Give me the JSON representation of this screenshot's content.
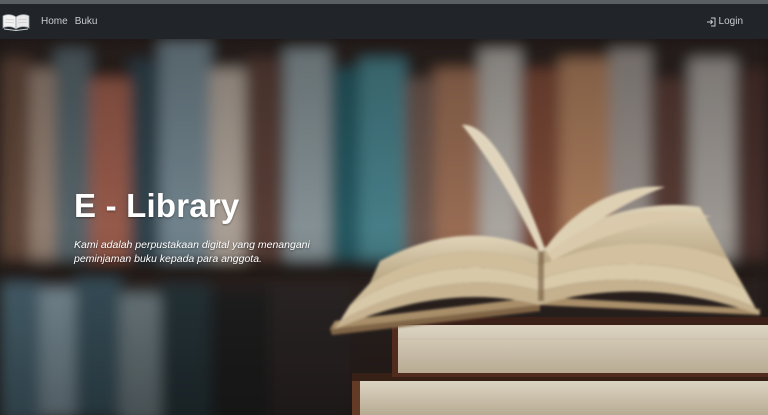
{
  "navbar": {
    "logo_icon": "open-book-icon",
    "links": [
      {
        "label": "Home"
      },
      {
        "label": "Buku"
      }
    ],
    "login": {
      "icon": "login-icon",
      "label": "Login"
    }
  },
  "hero": {
    "title": "E - Library",
    "description": "Kami adalah perpustakaan digital yang menangani peminjaman buku kepada para anggota.",
    "background_image": "blurred-bookshelf-with-open-book-photo"
  },
  "colors": {
    "navbar_bg": "#212529",
    "nav_text": "#c9cdd1",
    "hero_text": "#ffffff"
  }
}
